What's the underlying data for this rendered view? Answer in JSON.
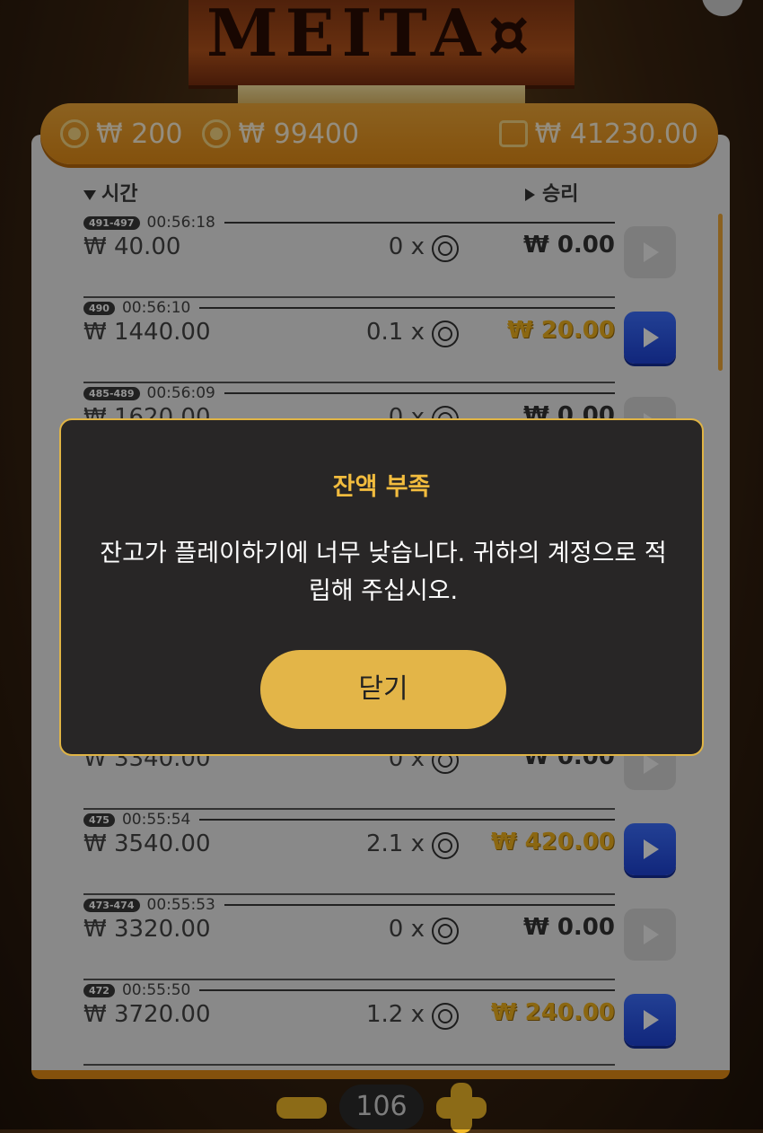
{
  "balances": {
    "bet": "₩ 200",
    "total": "₩ 99400",
    "wallet": "₩ 41230.00"
  },
  "history": {
    "header_time": "시간",
    "header_win": "승리",
    "rows": [
      {
        "range": "491-497",
        "time": "00:56:18",
        "amount": "₩ 40.00",
        "mult": "0 x",
        "win": "₩ 0.00",
        "active": false
      },
      {
        "range": "490",
        "time": "00:56:10",
        "amount": "₩ 1440.00",
        "mult": "0.1 x",
        "win": "₩ 20.00",
        "active": true
      },
      {
        "range": "485-489",
        "time": "00:56:09",
        "amount": "₩ 1620.00",
        "mult": "0 x",
        "win": "₩ 0.00",
        "active": false
      },
      {
        "range": "",
        "time": "",
        "amount": "₩ 3340.00",
        "mult": "0 x",
        "win": "₩ 0.00",
        "active": false
      },
      {
        "range": "475",
        "time": "00:55:54",
        "amount": "₩ 3540.00",
        "mult": "2.1 x",
        "win": "₩ 420.00",
        "active": true
      },
      {
        "range": "473-474",
        "time": "00:55:53",
        "amount": "₩ 3320.00",
        "mult": "0 x",
        "win": "₩ 0.00",
        "active": false
      },
      {
        "range": "472",
        "time": "00:55:50",
        "amount": "₩ 3720.00",
        "mult": "1.2 x",
        "win": "₩ 240.00",
        "active": true
      }
    ]
  },
  "footer": {
    "count": "106"
  },
  "modal": {
    "title": "잔액 부족",
    "message": "잔고가 플레이하기에 너무 낮습니다. 귀하의 계정으로 적립해 주십시오.",
    "close_label": "닫기"
  },
  "colors": {
    "accent": "#e38c16",
    "gold": "#f0b21e",
    "play_active": "#2a55f0",
    "modal_border": "#e0b445"
  }
}
